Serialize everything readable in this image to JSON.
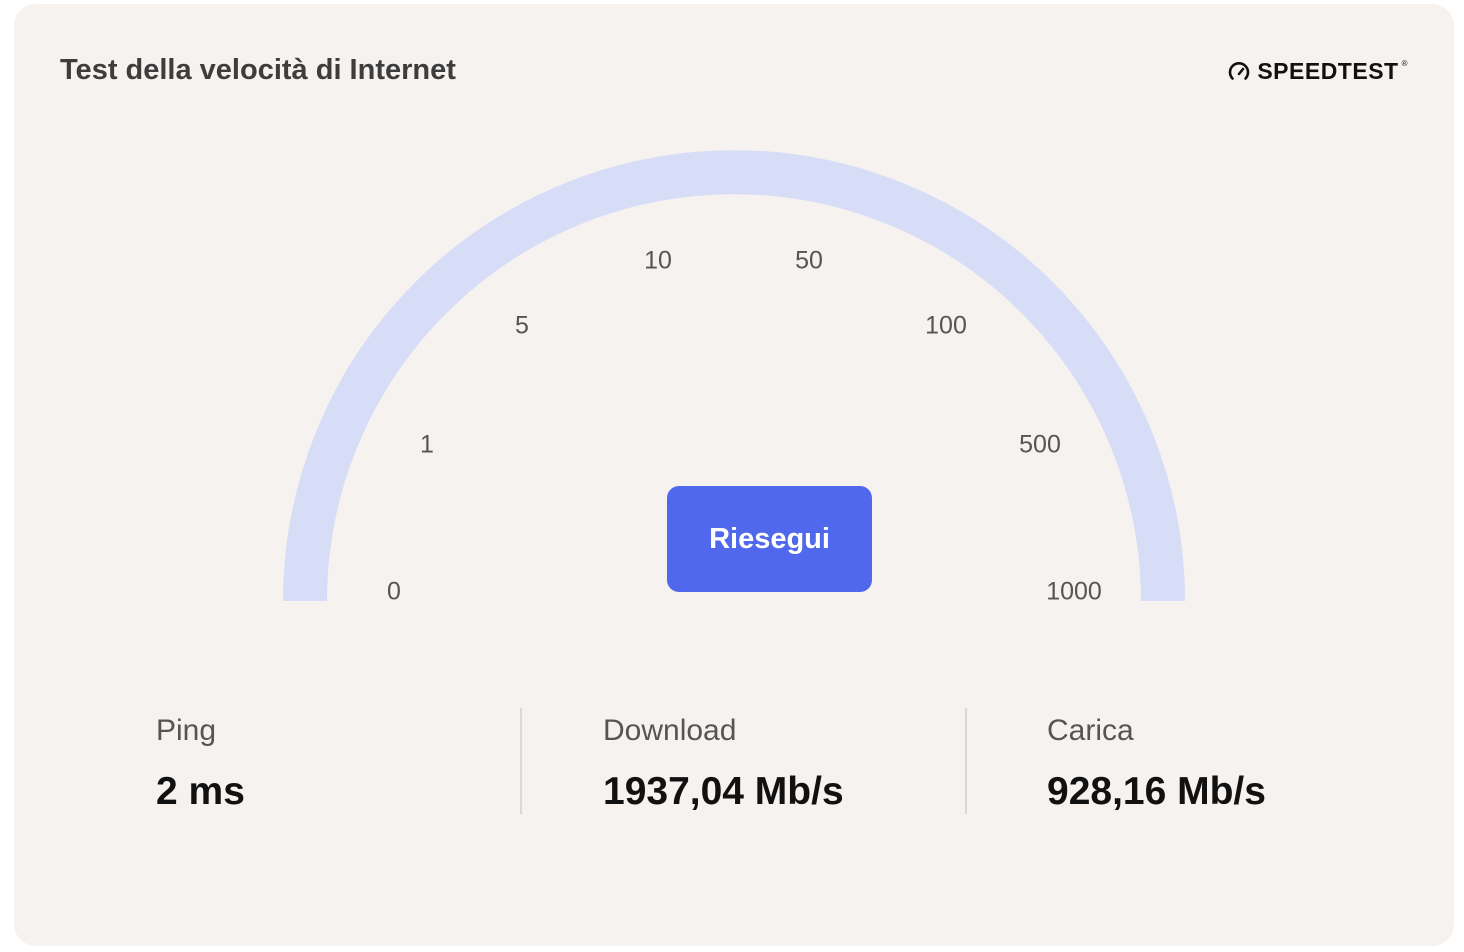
{
  "header": {
    "title": "Test della velocità di Internet",
    "brand": "SPEEDTEST",
    "brand_tm": "®"
  },
  "gauge": {
    "tick_labels": [
      "0",
      "1",
      "5",
      "10",
      "50",
      "100",
      "500",
      "1000"
    ],
    "arc_color": "#d8ddf7",
    "button_label": "Riesegui",
    "button_color": "#5069ec"
  },
  "stats": {
    "ping": {
      "label": "Ping",
      "value": "2 ms"
    },
    "download": {
      "label": "Download",
      "value": "1937,04 Mb/s"
    },
    "upload": {
      "label": "Carica",
      "value": "928,16 Mb/s"
    }
  }
}
